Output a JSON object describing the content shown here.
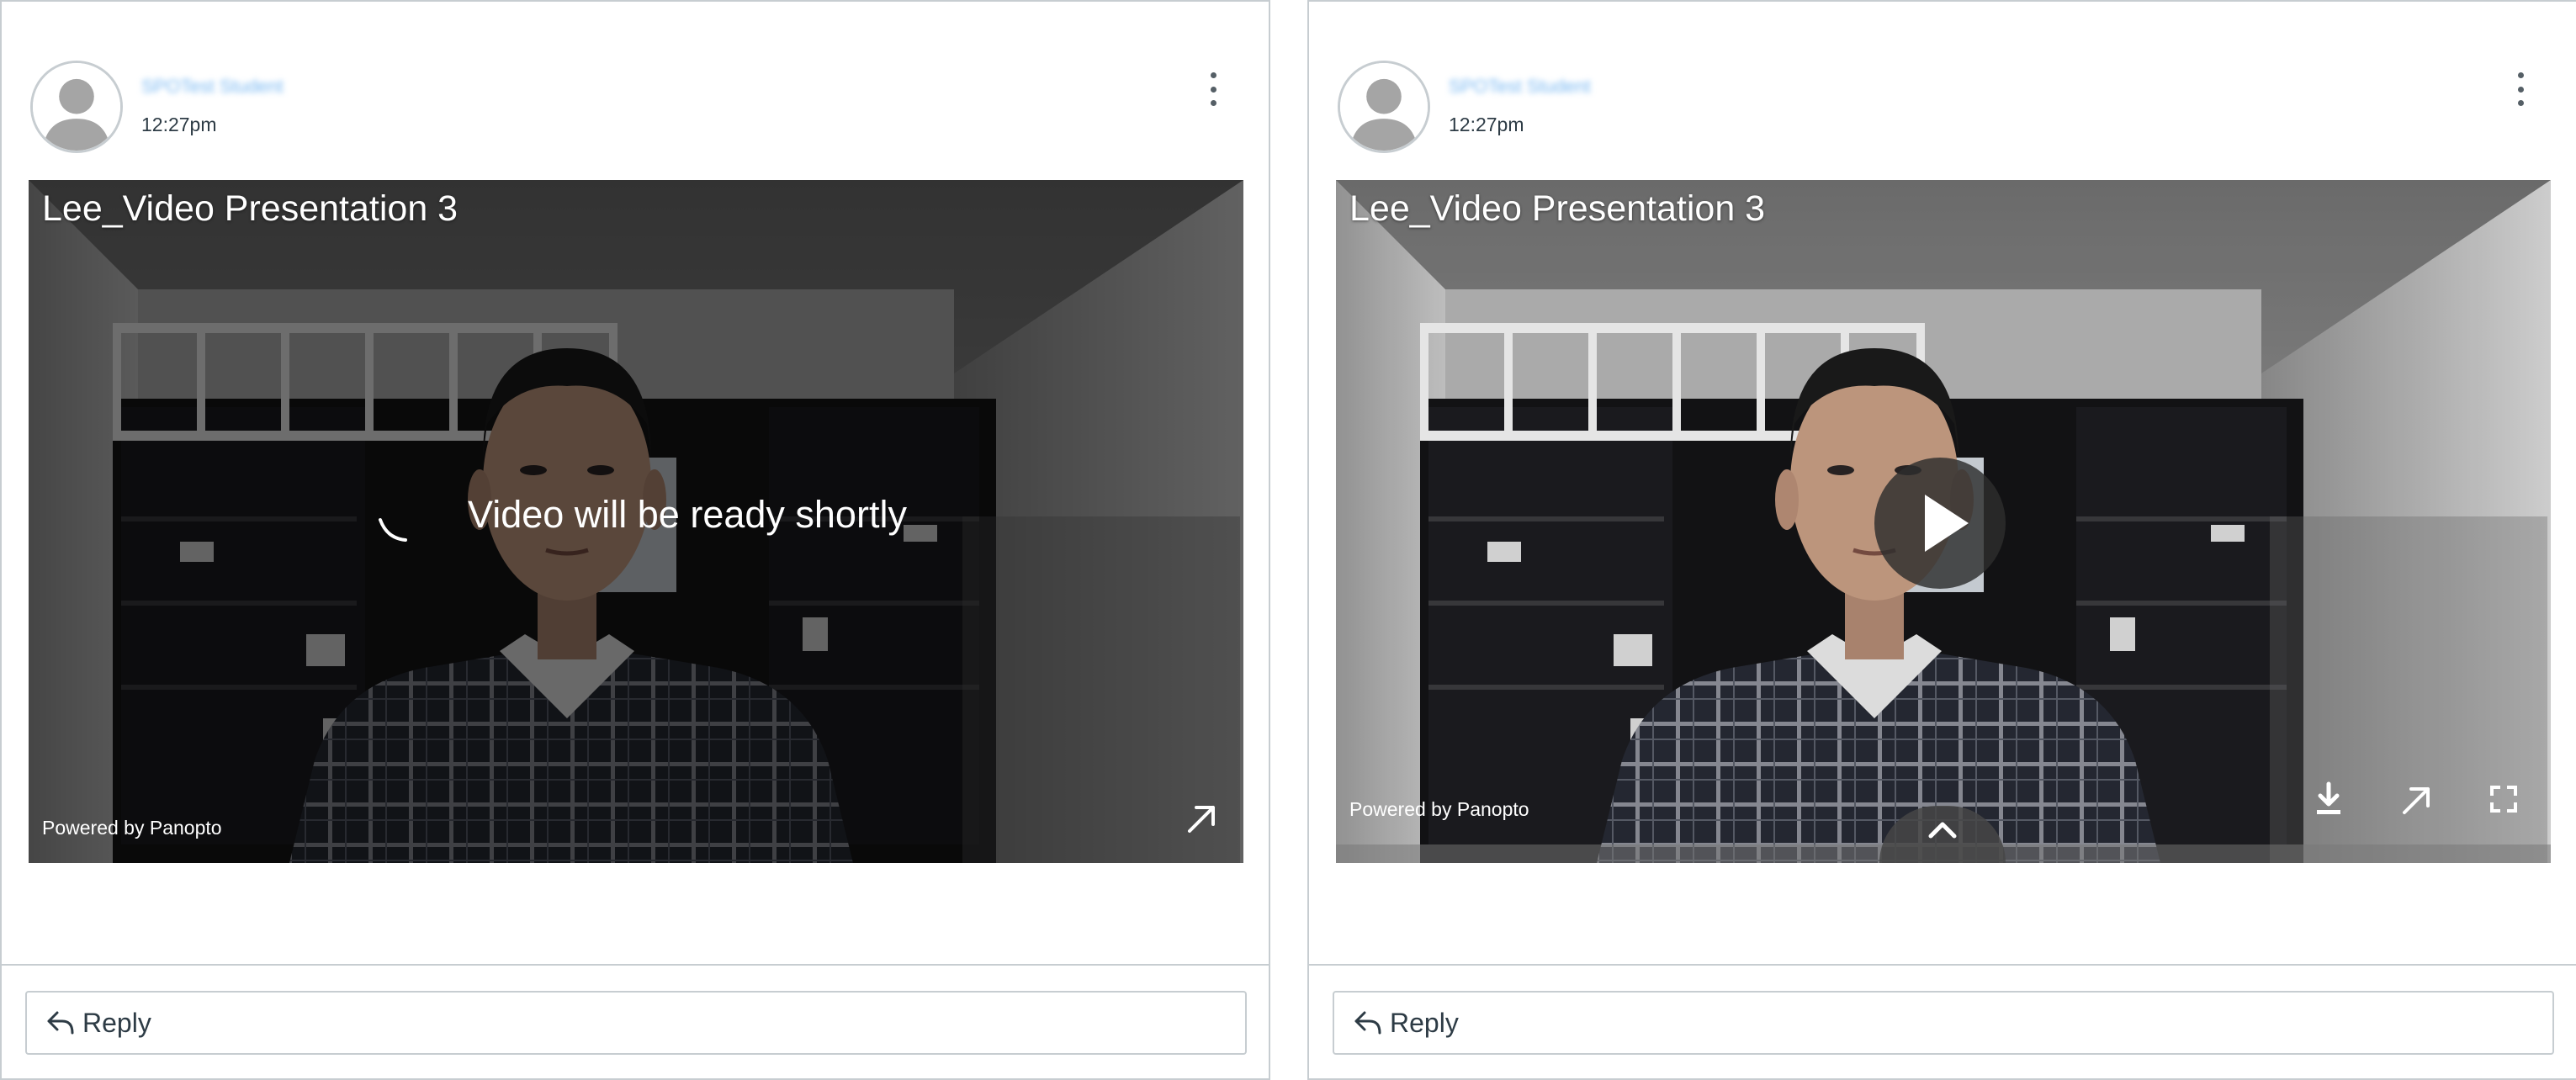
{
  "posts": [
    {
      "author": "SPOTest Student",
      "time": "12:27pm",
      "video": {
        "title": "Lee_Video Presentation 3",
        "status_message": "Video will be ready shortly",
        "powered_by": "Powered by Panopto",
        "state": "processing"
      },
      "reply_label": "Reply"
    },
    {
      "author": "SPOTest Student",
      "time": "12:27pm",
      "video": {
        "title": "Lee_Video Presentation 3",
        "powered_by": "Powered by Panopto",
        "state": "ready"
      },
      "reply_label": "Reply"
    }
  ],
  "icons": {
    "avatar": "default-user-avatar-icon",
    "menu": "more-options-vertical-icon",
    "spinner": "loading-spinner-icon",
    "open_external": "open-in-new-window-icon",
    "download": "download-icon",
    "fullscreen": "fullscreen-icon",
    "play": "play-icon",
    "expand": "chevron-up-icon",
    "reply": "reply-arrow-icon"
  },
  "colors": {
    "border": "#c7cdd1",
    "text": "#2d3b45",
    "author_link": "#0374b5"
  }
}
